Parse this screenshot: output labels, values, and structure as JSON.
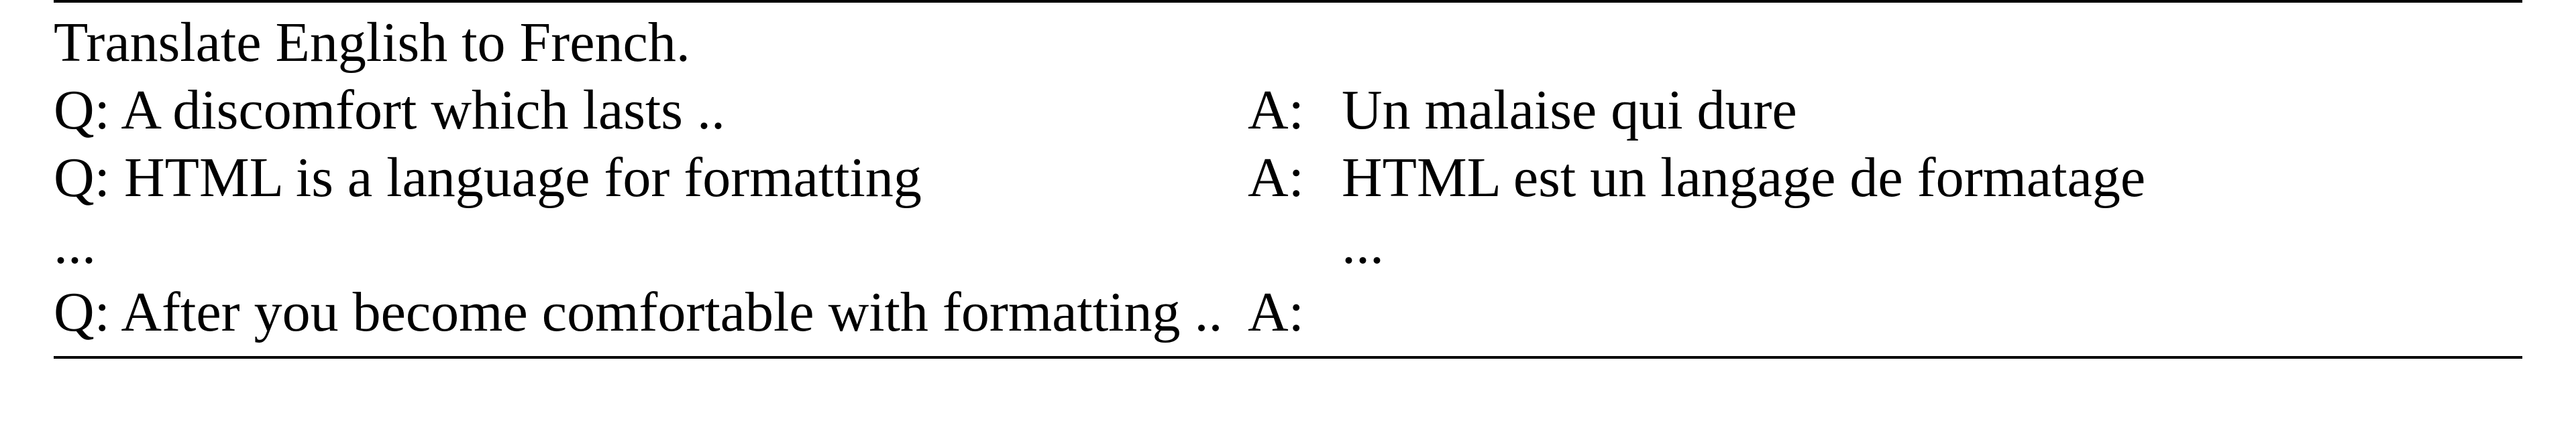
{
  "instruction": "Translate English to French.",
  "rows": [
    {
      "q": "Q: A discomfort which lasts ..",
      "alab": "A:",
      "a": "Un malaise qui dure"
    },
    {
      "q": "Q: HTML is a language for formatting",
      "alab": "A:",
      "a": "HTML est un langage de formatage"
    },
    {
      "q": "...",
      "alab": "",
      "a": "..."
    },
    {
      "q": "Q: After you become comfortable with formatting ..",
      "alab": "A:",
      "a": ""
    }
  ]
}
